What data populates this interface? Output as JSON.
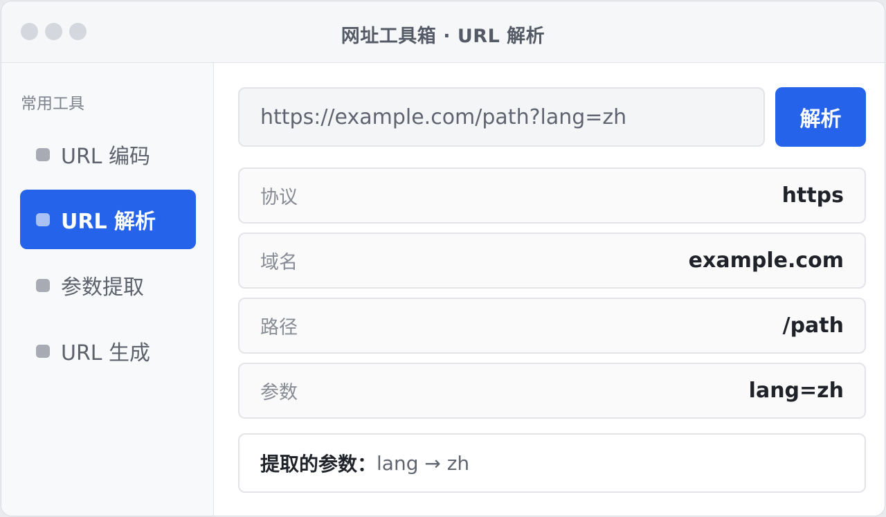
{
  "window": {
    "title": "网址工具箱 · URL 解析"
  },
  "sidebar": {
    "heading": "常用工具",
    "items": [
      {
        "label": "URL 编码",
        "active": false
      },
      {
        "label": "URL 解析",
        "active": true
      },
      {
        "label": "参数提取",
        "active": false
      },
      {
        "label": "URL 生成",
        "active": false
      }
    ]
  },
  "main": {
    "url_value": "https://example.com/path?lang=zh",
    "parse_button": "解析",
    "fields": [
      {
        "label": "协议",
        "value": "https"
      },
      {
        "label": "域名",
        "value": "example.com"
      },
      {
        "label": "路径",
        "value": "/path"
      },
      {
        "label": "参数",
        "value": "lang=zh"
      }
    ],
    "extract": {
      "label": "提取的参数：",
      "value": "lang → zh"
    }
  },
  "colors": {
    "accent": "#2563eb",
    "window_bg": "#ffffff",
    "sidebar_bg": "#f8f9fb"
  }
}
